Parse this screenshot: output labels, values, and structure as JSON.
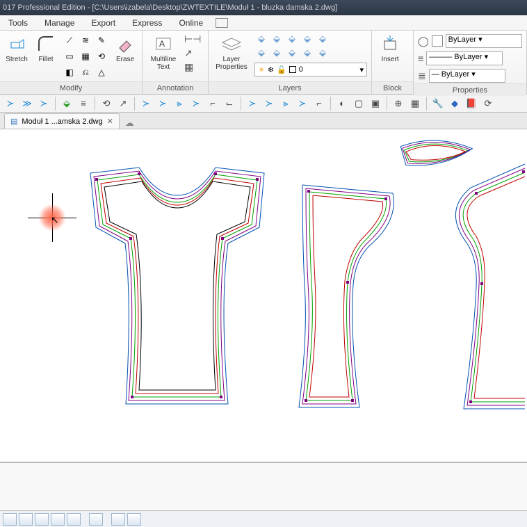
{
  "title": "017 Professional Edition - [C:\\Users\\izabela\\Desktop\\ZWTEXTILE\\Moduł 1 - bluzka damska 2.dwg]",
  "menus": [
    "Tools",
    "Manage",
    "Export",
    "Express",
    "Online"
  ],
  "panels": {
    "modify": {
      "title": "Modify",
      "stretch": "Stretch",
      "fillet": "Fillet",
      "erase": "Erase"
    },
    "annotation": {
      "title": "Annotation",
      "multiline": "Multiline\nText"
    },
    "layers": {
      "title": "Layers",
      "layerprops": "Layer\nProperties",
      "current": "0"
    },
    "block": {
      "title": "Block",
      "insert": "Insert"
    },
    "properties": {
      "title": "Properties",
      "bylayer": "ByLayer"
    }
  },
  "tab": {
    "label": "Moduł 1 ...amska 2.dwg"
  },
  "layer_swatch_color": "#000000",
  "colors": {
    "accent": "#1a88d4"
  }
}
